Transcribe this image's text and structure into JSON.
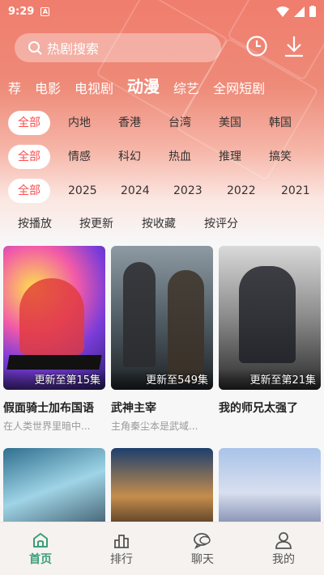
{
  "status_bar": {
    "time": "9:29",
    "badge": "A"
  },
  "search": {
    "placeholder": "热剧搜索"
  },
  "categories": [
    {
      "label": "荐",
      "active": false
    },
    {
      "label": "电影",
      "active": false
    },
    {
      "label": "电视剧",
      "active": false
    },
    {
      "label": "动漫",
      "active": true
    },
    {
      "label": "综艺",
      "active": false
    },
    {
      "label": "全网短剧",
      "active": false
    }
  ],
  "filters": {
    "region": [
      "全部",
      "内地",
      "香港",
      "台湾",
      "美国",
      "韩国"
    ],
    "genre": [
      "全部",
      "情感",
      "科幻",
      "热血",
      "推理",
      "搞笑"
    ],
    "year": [
      "全部",
      "2025",
      "2024",
      "2023",
      "2022",
      "2021"
    ]
  },
  "sort": [
    "按播放",
    "按更新",
    "按收藏",
    "按评分"
  ],
  "cards": [
    {
      "title": "假面骑士加布国语",
      "desc": "在人类世界里暗中...",
      "episode": "更新至第15集"
    },
    {
      "title": "武神主宰",
      "desc": "主角秦尘本是武域...",
      "episode": "更新至549集"
    },
    {
      "title": "我的师兄太强了",
      "desc": "",
      "episode": "更新至第21集"
    }
  ],
  "bottom_nav": [
    {
      "label": "首页",
      "icon": "home-icon",
      "active": true
    },
    {
      "label": "排行",
      "icon": "ranking-icon",
      "active": false
    },
    {
      "label": "聊天",
      "icon": "chat-icon",
      "active": false
    },
    {
      "label": "我的",
      "icon": "profile-icon",
      "active": false
    }
  ],
  "colors": {
    "accent": "#ff4c4c",
    "nav_active": "#3a9e7a",
    "header": "#f07d6d"
  }
}
